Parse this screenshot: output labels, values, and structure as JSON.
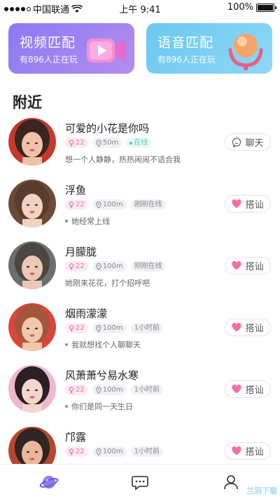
{
  "status_bar": {
    "carrier": "中国联通",
    "time": "上午 9:41",
    "battery": "100%",
    "battery_level": 1.0
  },
  "match_cards": [
    {
      "title": "视频匹配",
      "subtitle": "有896人正在玩",
      "icon": "video-camera-icon"
    },
    {
      "title": "语音匹配",
      "subtitle": "有896人正在玩",
      "icon": "microphone-icon"
    }
  ],
  "section_title": "附近",
  "users": [
    {
      "name": "可爱的小花是你吗",
      "age": "22",
      "distance": "50m",
      "status": "在线",
      "status_online": true,
      "desc": "想一个人静静，热热闹闹不适合我",
      "desc_dot": false,
      "action": "聊天",
      "action_icon": "chat-bubble-icon",
      "colors": [
        "#c43a2d",
        "#f0c3a9",
        "#3b2520"
      ]
    },
    {
      "name": "浮鱼",
      "age": "22",
      "distance": "100m",
      "status": "刚刚在线",
      "status_online": false,
      "desc": "她经常上线",
      "desc_dot": true,
      "action": "搭讪",
      "action_icon": "heart-icon",
      "colors": [
        "#6b4a3a",
        "#f1d3c2",
        "#5a3b2d"
      ]
    },
    {
      "name": "月朦胧",
      "age": "22",
      "distance": "100m",
      "status": "刚刚在线",
      "status_online": false,
      "desc": "她刚来花花，打个招呼吧",
      "desc_dot": false,
      "action": "搭讪",
      "action_icon": "heart-icon",
      "colors": [
        "#6b6f6d",
        "#ecc8b6",
        "#4a4642"
      ]
    },
    {
      "name": "烟雨濛濛",
      "age": "22",
      "distance": "100m",
      "status": "1小时前",
      "status_online": false,
      "desc": "我就想找个人聊聊天",
      "desc_dot": true,
      "action": "搭讪",
      "action_icon": "heart-icon",
      "colors": [
        "#d7473a",
        "#f2c8ad",
        "#a5553b"
      ]
    },
    {
      "name": "风萧萧兮易水寒",
      "age": "22",
      "distance": "100m",
      "status": "1小时前",
      "status_online": false,
      "desc": "你们是同一天生日",
      "desc_dot": true,
      "action": "搭讪",
      "action_icon": "heart-icon",
      "colors": [
        "#f0b8c8",
        "#f4d7cc",
        "#2a1f22"
      ]
    },
    {
      "name": "邝露",
      "age": "22",
      "distance": "100m",
      "status": "1小时前",
      "status_online": false,
      "desc": "",
      "desc_dot": false,
      "action": "搭讪",
      "action_icon": "heart-icon",
      "colors": [
        "#b5462f",
        "#eab89c",
        "#2f2522"
      ]
    }
  ],
  "tabbar": [
    {
      "name": "nearby",
      "icon": "planet-icon",
      "active": true
    },
    {
      "name": "chat",
      "icon": "message-icon",
      "active": false
    },
    {
      "name": "mine",
      "icon": "profile-icon",
      "active": false
    }
  ],
  "colors": {
    "video_gradient": [
      "#8a7bf2",
      "#b58cf0"
    ],
    "voice_gradient": [
      "#6cc7f0",
      "#8ed8f5"
    ],
    "gender_pink": "#e576a9",
    "heart_pink": "#f36ea4",
    "online_teal": "#5cc5c7"
  },
  "watermark": "兰羽下载"
}
